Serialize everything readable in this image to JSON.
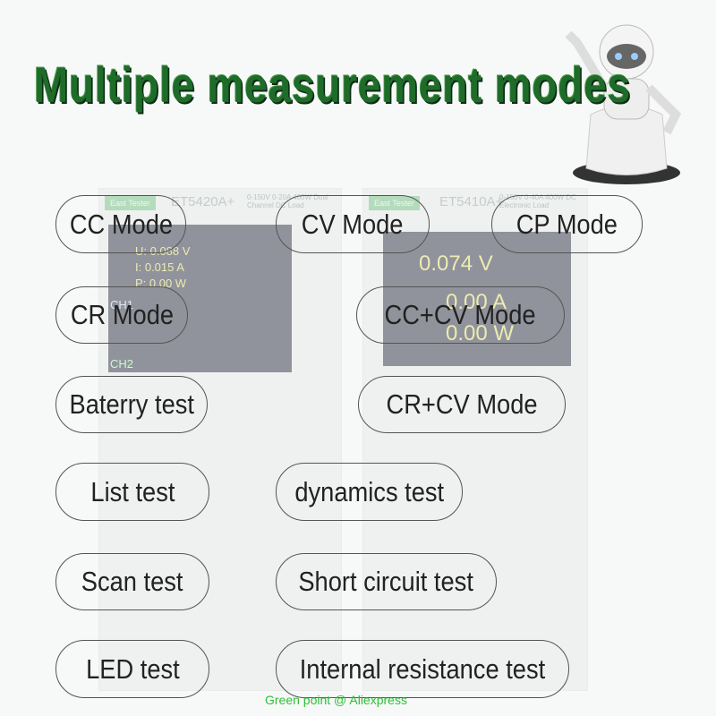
{
  "title": "Multiple measurement modes",
  "devices": [
    {
      "brand": "East Tester",
      "model": "ET5420A+",
      "spec": "0-150V 0-20A 400W Dual Channel DC Load",
      "readings": [
        "U: 0.088 V",
        "I: 0.015 A",
        "P: 0.00 W"
      ],
      "channels": [
        "CH1",
        "CH2"
      ],
      "mode": "CC"
    },
    {
      "brand": "East Tester",
      "model": "ET5410A+",
      "spec": "0-150V 0-40A 400W DC Electronic Load",
      "readings": [
        "0.074 V",
        "0.00 A",
        "0.00 W"
      ],
      "mode": "CC"
    }
  ],
  "modes": [
    "CC Mode",
    "CV Mode",
    "CP Mode",
    "CR Mode",
    "CC+CV Mode",
    "Baterry test",
    "CR+CV Mode",
    "List test",
    "dynamics test",
    "Scan test",
    "Short circuit test",
    "LED test",
    "Internal resistance test"
  ],
  "footer": "Green point @ Aliexpress",
  "colors": {
    "title": "#1f6b2a",
    "footer": "#2fbf3a",
    "pill_border": "#555555"
  }
}
